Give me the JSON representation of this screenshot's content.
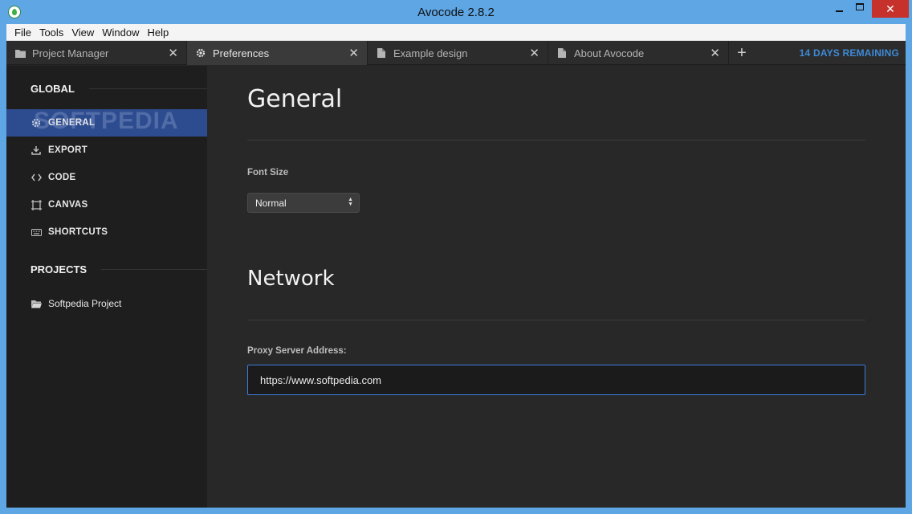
{
  "window": {
    "title": "Avocode 2.8.2",
    "close_glyph": "✕"
  },
  "menu": [
    "File",
    "Tools",
    "View",
    "Window",
    "Help"
  ],
  "tabs": [
    {
      "label": "Project Manager",
      "icon": "folder-icon",
      "close": "✕"
    },
    {
      "label": "Preferences",
      "icon": "gear-icon",
      "close": "✕"
    },
    {
      "label": "Example design",
      "icon": "document-icon",
      "close": "✕"
    },
    {
      "label": "About Avocode",
      "icon": "document-icon",
      "close": "✕"
    }
  ],
  "tab_add_glyph": "+",
  "trial": {
    "days_remaining": "14 DAYS REMAINING"
  },
  "sidebar": {
    "global_heading": "GLOBAL",
    "items": [
      {
        "label": "GENERAL",
        "icon": "gear-icon",
        "active": true
      },
      {
        "label": "EXPORT",
        "icon": "download-icon"
      },
      {
        "label": "CODE",
        "icon": "code-icon"
      },
      {
        "label": "CANVAS",
        "icon": "canvas-icon"
      },
      {
        "label": "SHORTCUTS",
        "icon": "keyboard-icon"
      }
    ],
    "projects_heading": "PROJECTS",
    "projects": [
      {
        "label": "Softpedia Project",
        "icon": "folder-open-icon"
      }
    ],
    "watermark": "SOFTPEDIA"
  },
  "content": {
    "general_title": "General",
    "font_size_label": "Font Size",
    "font_size_value": "Normal",
    "network_title": "Network",
    "proxy_label": "Proxy Server Address:",
    "proxy_value": "https://www.softpedia.com"
  },
  "colors": {
    "accent": "#3e8ad8",
    "active_nav": "#2d4c8f",
    "frame": "#5ea6e4",
    "close": "#c7312b"
  }
}
